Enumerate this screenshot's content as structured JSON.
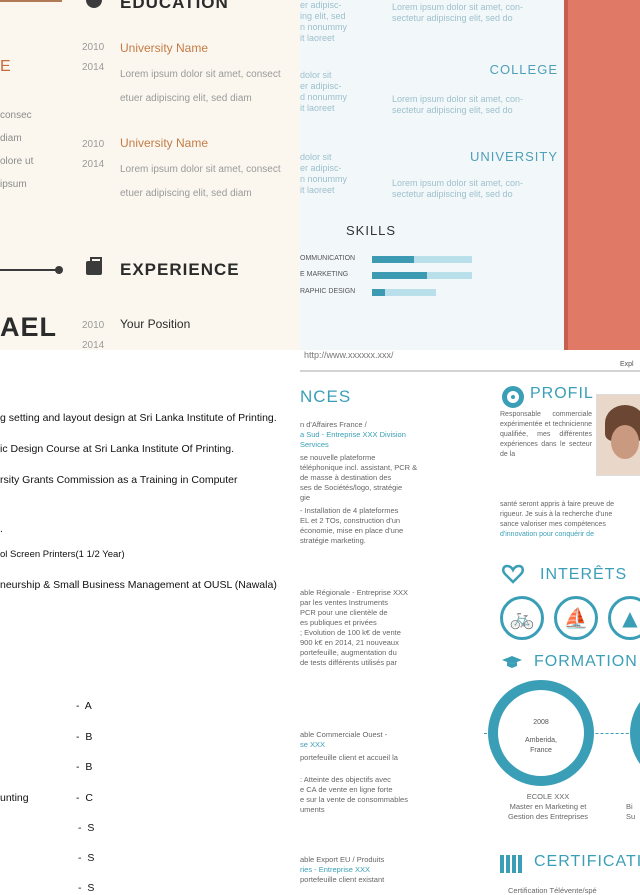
{
  "top_left": {
    "education_heading": "EDUCATION",
    "accent_letter": "E",
    "left_fragments": [
      "consec",
      "diam",
      "olore ut",
      "ipsum"
    ],
    "entries": [
      {
        "year_start": "2010",
        "year_end": "2014",
        "title": "University Name",
        "desc": "Lorem ipsum dolor sit amet, consect etuer adipiscing elit, sed diam"
      },
      {
        "year_start": "2010",
        "year_end": "2014",
        "title": "University Name",
        "desc": "Lorem ipsum dolor sit amet, consect etuer adipiscing elit, sed diam"
      }
    ],
    "experience_heading": "EXPERIENCE",
    "name_fragment": "AEL",
    "position_year_start": "2010",
    "position_year_end": "2014",
    "position_title": "Your Position"
  },
  "top_right": {
    "fragments_left": [
      "er adipisc-\ning elit, sed\nn nonummy\nit laoreet",
      "dolor sit\ner adipisc-\nd nonummy\nit laoreet",
      "dolor sit\ner adipisc-\nn nonummy\nit laoreet"
    ],
    "fragments_right": [
      "Lorem ipsum dolor sit amet, con-\nsectetur adipiscing elit, sed do",
      "Lorem ipsum dolor sit amet, con-\nsectetur adipiscing elit, sed do",
      "Lorem ipsum dolor sit amet, con-\nsectetur adipiscing elit, sed do"
    ],
    "headers": [
      "COLLEGE",
      "UNIVERSITY"
    ],
    "skills_title": "SKILLS",
    "skills": [
      {
        "label": "OMMUNICATION",
        "level": 0.42
      },
      {
        "label": "E MARKETING",
        "level": 0.55
      },
      {
        "label": "RAPHIC DESIGN",
        "level": 0.2
      }
    ],
    "accent": "#3d9ab3",
    "side_color": "#e07a67"
  },
  "bottom_left": {
    "lines": [
      "g setting and layout design at Sri Lanka Institute of Printing.",
      "ic Design Course at Sri Lanka Institute Of Printing.",
      "rsity Grants Commission as a  Training in Computer",
      ".",
      "ol Screen Printers(1 1/2 Year)",
      "neurship & Small Business Management  at OUSL (Nawala)"
    ],
    "subject_fragment": "unting",
    "grades": [
      "-  A",
      "-  B",
      "-  B",
      "-  C",
      "-  S",
      "-  S",
      "-  S"
    ]
  },
  "bottom_right": {
    "top_fragment": "http://www.xxxxxx.xxx/",
    "explore_fragment": "Expl",
    "section_fragment": "NCES",
    "blocks": [
      {
        "lines": [
          "n d'Affaires France /",
          "a Sud - Entreprise XXX Division"
        ],
        "blue": [
          "Services"
        ],
        "more": [
          "se nouvelle plateforme",
          "téléphonique incl. assistant, PCR &",
          "de masse à destination des",
          "ses de  Sociétés/logo, stratégie",
          "gie",
          "- Installation de 4 plateformes",
          "EL et 2 TOs, construction d'un",
          "économie, mise en place d'une",
          "stratégie marketing."
        ]
      },
      {
        "lines": [
          "able Régionale - Entreprise XXX",
          "par les ventes Instruments",
          "PCR pour une  clientèle de",
          "es publiques et privées",
          "; Evolution de 100 k€ de vente",
          "900 k€ en 2014,  21 nouveaux",
          "portefeuille, augmentation du",
          "de tests  différents utilisés par"
        ]
      },
      {
        "lines": [
          "able Commerciale Ouest -",
          "se XXX"
        ],
        "more": [
          "portefeuille client et accueil la",
          ": Atteinte des objectifs avec",
          "e CA de vente en ligne forte",
          "e sur la vente de consommables",
          "uments"
        ]
      },
      {
        "lines": [
          "able Export EU / Produits",
          "ries - Entreprise XXX",
          "portefeuille client existant"
        ]
      }
    ],
    "profil_title": "PROFIL",
    "profil_text": "Responsable commerciale expérimentée et technicienne qualifiée, mes différentes expériences dans le secteur de la",
    "profil_wide": [
      "santé seront appris  à faire preuve de",
      "rigueur. Je suis à la recherche d'une",
      "sance  valoriser mes compétences",
      "d'innovation pour conquérir de"
    ],
    "interets_title": "INTERÊTS",
    "formation_title": "FORMATION",
    "school": {
      "year": "2008",
      "place": "Amberida, France",
      "name": "ECOLE XXX",
      "degree": "Master en Marketing et",
      "degree2": "Gestion des Entreprises"
    },
    "school2_frag": {
      "line1": "Bi",
      "line2": "Su"
    },
    "certification_title": "CERTIFICATIO",
    "cert_line": "Certification Télévente/spé",
    "accent": "#3a9fb6"
  }
}
